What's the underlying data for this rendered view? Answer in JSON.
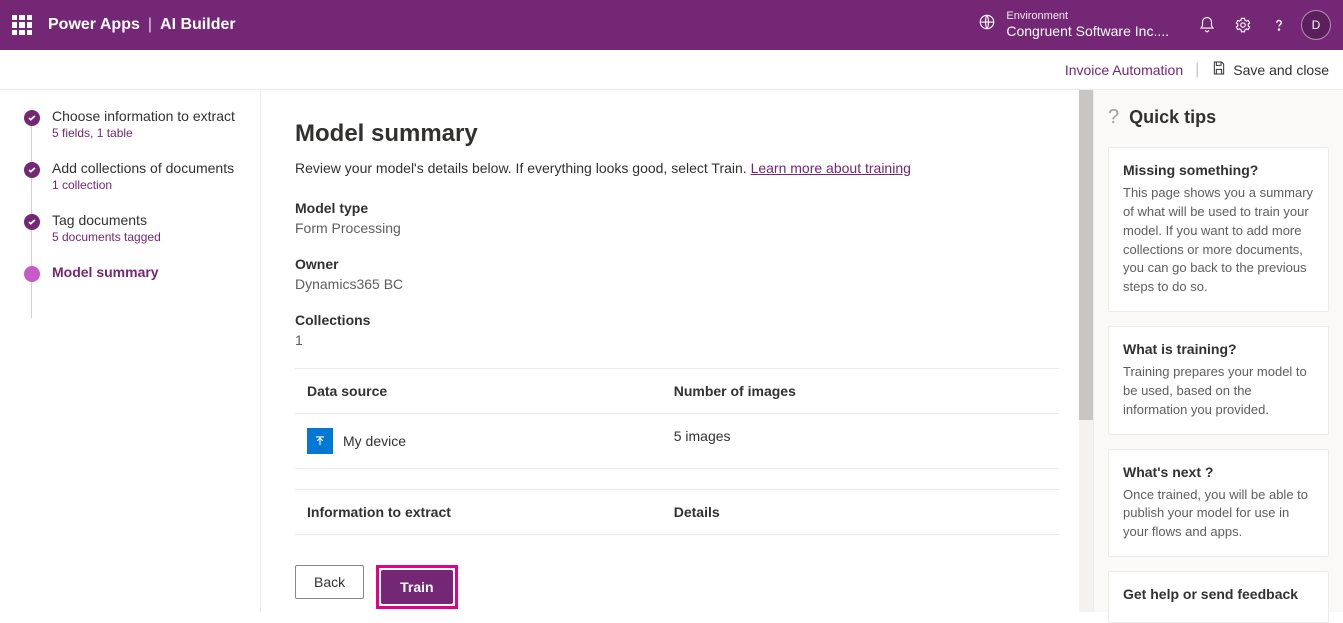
{
  "header": {
    "app": "Power Apps",
    "divider": "|",
    "section": "AI Builder",
    "env_label": "Environment",
    "env_name": "Congruent Software Inc....",
    "avatar_initial": "D"
  },
  "subheader": {
    "breadcrumb": "Invoice Automation",
    "save_label": "Save and close",
    "divider": "|"
  },
  "steps": [
    {
      "title": "Choose information to extract",
      "sub": "5 fields, 1 table",
      "done": true
    },
    {
      "title": "Add collections of documents",
      "sub": "1 collection",
      "done": true
    },
    {
      "title": "Tag documents",
      "sub": "5 documents tagged",
      "done": true
    },
    {
      "title": "Model summary",
      "sub": "",
      "current": true
    }
  ],
  "main": {
    "title": "Model summary",
    "desc_pre": "Review your model's details below. If everything looks good, select Train. ",
    "desc_link": "Learn more about training",
    "fields": {
      "type_label": "Model type",
      "type_value": "Form Processing",
      "owner_label": "Owner",
      "owner_value": "Dynamics365 BC",
      "coll_label": "Collections",
      "coll_value": "1"
    },
    "table1": {
      "col1": "Data source",
      "col2": "Number of images",
      "row_source": "My device",
      "row_images": "5 images"
    },
    "table2": {
      "col1": "Information to extract",
      "col2": "Details"
    },
    "back_label": "Back",
    "train_label": "Train"
  },
  "tips": {
    "heading": "Quick tips",
    "cards": [
      {
        "title": "Missing something?",
        "body": "This page shows you a summary of what will be used to train your model. If you want to add more collections or more documents, you can go back to the previous steps to do so."
      },
      {
        "title": "What is training?",
        "body": "Training prepares your model to be used, based on the information you provided."
      },
      {
        "title": "What's next ?",
        "body": "Once trained, you will be able to publish your model for use in your flows and apps."
      },
      {
        "title": "Get help or send feedback",
        "body": ""
      }
    ]
  }
}
